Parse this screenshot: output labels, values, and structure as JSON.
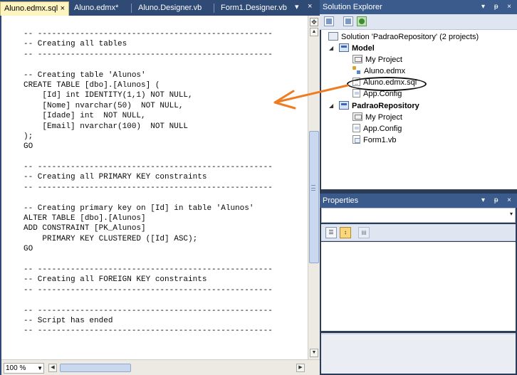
{
  "editor": {
    "tabs": [
      {
        "label": "Aluno.edmx.sql",
        "active": true,
        "close": "×"
      },
      {
        "label": "Aluno.edmx*",
        "active": false
      },
      {
        "label": "Aluno.Designer.vb",
        "active": false
      },
      {
        "label": "Form1.Designer.vb",
        "active": false
      }
    ],
    "tab_dropdown": "▾",
    "tab_close": "×",
    "code_lines": [
      "-- --------------------------------------------------",
      "-- Creating all tables",
      "-- --------------------------------------------------",
      "",
      "-- Creating table 'Alunos'",
      "CREATE TABLE [dbo].[Alunos] (",
      "    [Id] int IDENTITY(1,1) NOT NULL,",
      "    [Nome] nvarchar(50)  NOT NULL,",
      "    [Idade] int  NOT NULL,",
      "    [Email] nvarchar(100)  NOT NULL",
      ");",
      "GO",
      "",
      "-- --------------------------------------------------",
      "-- Creating all PRIMARY KEY constraints",
      "-- --------------------------------------------------",
      "",
      "-- Creating primary key on [Id] in table 'Alunos'",
      "ALTER TABLE [dbo].[Alunos]",
      "ADD CONSTRAINT [PK_Alunos]",
      "    PRIMARY KEY CLUSTERED ([Id] ASC);",
      "GO",
      "",
      "-- --------------------------------------------------",
      "-- Creating all FOREIGN KEY constraints",
      "-- --------------------------------------------------",
      "",
      "-- --------------------------------------------------",
      "-- Script has ended",
      "-- --------------------------------------------------"
    ],
    "zoom": "100 %"
  },
  "solution_explorer": {
    "title": "Solution Explorer",
    "controls": "▾ ᵽ ×",
    "tree": {
      "solution": "Solution 'PadraoRepository' (2 projects)",
      "model": {
        "label": "Model",
        "items": [
          "My Project",
          "Aluno.edmx",
          "Aluno.edmx.sql",
          "App.Config"
        ]
      },
      "repository": {
        "label": "PadraoRepository",
        "items": [
          "My Project",
          "App.Config",
          "Form1.vb"
        ]
      }
    }
  },
  "properties": {
    "title": "Properties",
    "controls": "▾ ᵽ ×",
    "combo_arrow": "▾"
  },
  "colors": {
    "annotation_arrow": "#f07c22",
    "tab_active": "#fdf4bf",
    "panel_title": "#3b5b8c"
  }
}
